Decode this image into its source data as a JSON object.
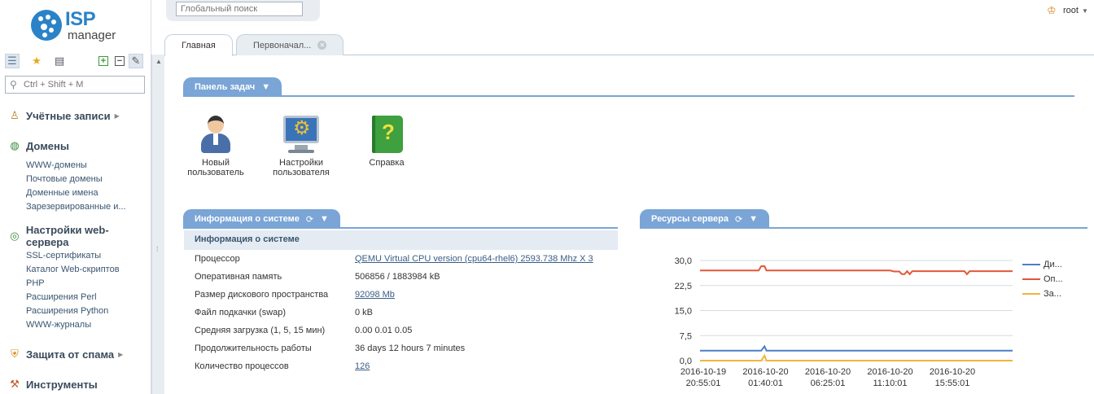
{
  "logo": {
    "word1": "ISP",
    "word2": "manager"
  },
  "global_search": {
    "placeholder": "Глобальный поиск"
  },
  "user": {
    "name": "root"
  },
  "sidebar_search": {
    "placeholder": "Ctrl + Shift + M"
  },
  "sidebar": {
    "groups": [
      {
        "label": "Учётные записи",
        "items": []
      },
      {
        "label": "Домены",
        "items": [
          "WWW-домены",
          "Почтовые домены",
          "Доменные имена",
          "Зарезервированные и..."
        ]
      },
      {
        "label": "Настройки web-сервера",
        "items": [
          "SSL-сертификаты",
          "Каталог Web-скриптов",
          "PHP",
          "Расширения Perl",
          "Расширения Python",
          "WWW-журналы"
        ]
      },
      {
        "label": "Защита от спама",
        "items": []
      },
      {
        "label": "Инструменты",
        "items": []
      }
    ]
  },
  "tabs": [
    {
      "label": "Главная",
      "active": true
    },
    {
      "label": "Первоначал...",
      "active": false
    }
  ],
  "task_panel": {
    "title": "Панель задач",
    "items": [
      {
        "line1": "Новый",
        "line2": "пользователь"
      },
      {
        "line1": "Настройки",
        "line2": "пользователя"
      },
      {
        "line1": "Справка",
        "line2": ""
      }
    ]
  },
  "system_info": {
    "title": "Информация о системе",
    "subtitle": "Информация о системе",
    "rows": [
      {
        "key": "Процессор",
        "value": "QEMU Virtual CPU version (cpu64-rhel6) 2593.738 Mhz X 3",
        "link": true
      },
      {
        "key": "Оперативная память",
        "value": "506856 / 1883984 kB",
        "link": false
      },
      {
        "key": "Размер дискового пространства",
        "value": "92098 Mb",
        "link": true
      },
      {
        "key": "Файл подкачки (swap)",
        "value": "0 kB",
        "link": false
      },
      {
        "key": "Средняя загрузка (1, 5, 15 мин)",
        "value": "0.00 0.01 0.05",
        "link": false
      },
      {
        "key": "Продолжительность работы",
        "value": "36 days 12 hours 7 minutes",
        "link": false
      },
      {
        "key": "Количество процессов",
        "value": "126",
        "link": true
      }
    ]
  },
  "server_resources": {
    "title": "Ресурсы сервера"
  },
  "chart_data": {
    "type": "line",
    "title": "",
    "xlabel": "",
    "ylabel": "",
    "ylim": [
      0,
      30
    ],
    "yticks": [
      "30,0",
      "22,5",
      "15,0",
      "7,5",
      "0,0"
    ],
    "xticks": [
      {
        "date": "2016-10-19",
        "time": "20:55:01"
      },
      {
        "date": "2016-10-20",
        "time": "01:40:01"
      },
      {
        "date": "2016-10-20",
        "time": "06:25:01"
      },
      {
        "date": "2016-10-20",
        "time": "11:10:01"
      },
      {
        "date": "2016-10-20",
        "time": "15:55:01"
      }
    ],
    "x_hours": [
      0,
      1.8,
      4.5,
      4.7,
      4.95,
      5.1,
      5.3,
      10,
      14.6,
      14.9,
      15.3,
      15.5,
      15.7,
      15.9,
      16.1,
      16.3,
      17,
      20.3,
      20.5,
      20.7,
      21.5,
      24
    ],
    "series": [
      {
        "name": "Ди...",
        "color": "#4d7ec6",
        "values": [
          3.0,
          3.0,
          3.0,
          3.0,
          4.3,
          3.0,
          3.0,
          3.0,
          3.0,
          3.0,
          3.0,
          3.0,
          3.0,
          3.0,
          3.0,
          3.0,
          3.0,
          3.0,
          3.0,
          3.0,
          3.0,
          3.0
        ]
      },
      {
        "name": "Оп...",
        "color": "#e2573a",
        "values": [
          27.0,
          27.0,
          27.0,
          28.3,
          28.3,
          27.0,
          27.0,
          27.0,
          27.0,
          26.7,
          26.7,
          25.9,
          25.9,
          26.8,
          25.9,
          26.8,
          26.8,
          26.8,
          25.9,
          26.8,
          26.8,
          26.8
        ]
      },
      {
        "name": "За...",
        "color": "#f3b33d",
        "values": [
          0,
          0,
          0,
          0,
          1.5,
          0,
          0,
          0,
          0,
          0,
          0,
          0,
          0,
          0,
          0,
          0,
          0,
          0,
          0,
          0,
          0,
          0
        ]
      }
    ],
    "grid": true,
    "legend": "right"
  }
}
